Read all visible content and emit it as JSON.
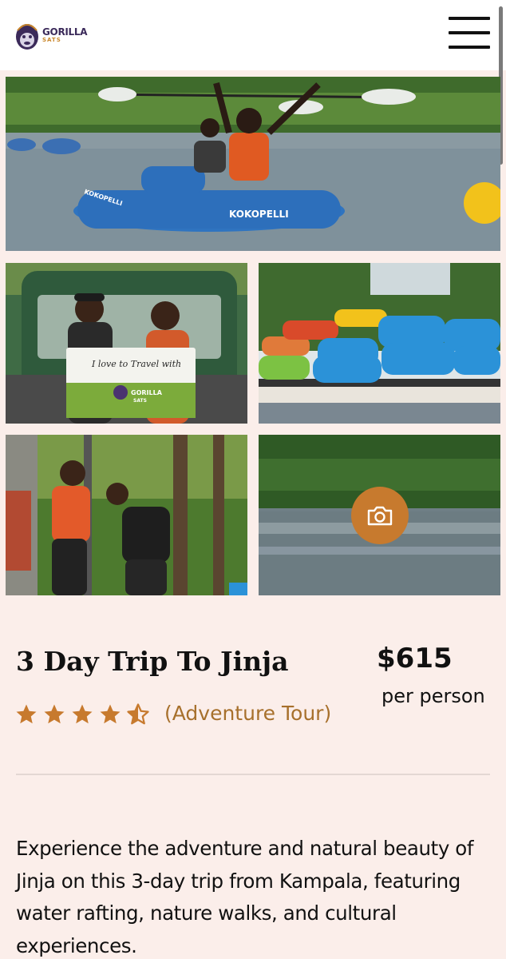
{
  "header": {
    "brand_name": "GORILLA",
    "brand_sub": "SATS",
    "menu_icon": "hamburger-menu-icon"
  },
  "gallery": {
    "photo_1": {
      "boat_text": "KOKOPELLI",
      "boat_text_2": "KOKOPELLI"
    },
    "photo_2": {
      "sign_text": "I love to Travel with",
      "sign_brand": "GORILLA",
      "sign_brand_sub": "SATS"
    },
    "camera_icon": "camera-icon"
  },
  "tour": {
    "title": "3 Day Trip To Jinja",
    "price": "$615",
    "price_unit": "per person",
    "rating": 4.5,
    "rating_max": 5,
    "type": "(Adventure Tour)",
    "description": "Experience the adventure and natural beauty of Jinja on this 3-day trip from Kampala, featuring water rafting, nature walks, and cultural experiences."
  },
  "colors": {
    "accent": "#c77a2e",
    "star": "#c77a2e",
    "type_text": "#a7702c",
    "background": "#fbeeea"
  }
}
